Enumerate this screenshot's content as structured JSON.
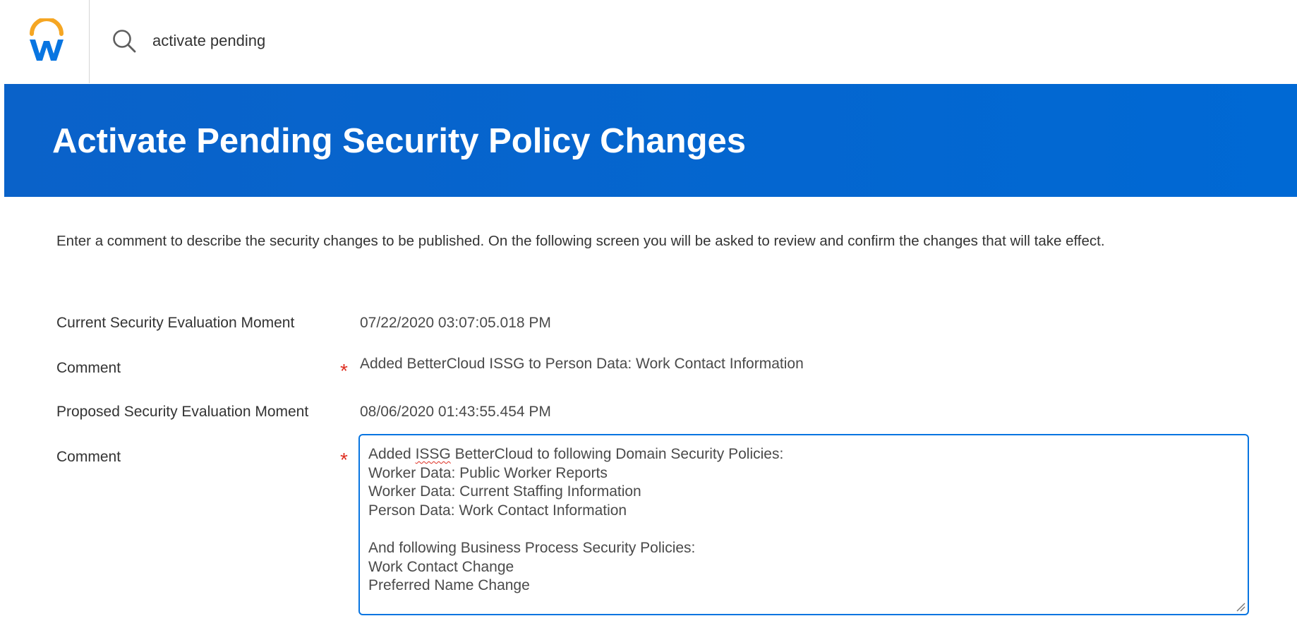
{
  "app": {
    "logo_icon": "workday-logo-icon",
    "brand_colors": {
      "arc": "#f5a623",
      "letter": "#0875e1",
      "header": "#0066cc"
    }
  },
  "search": {
    "icon": "search-icon",
    "value": "activate pending"
  },
  "page": {
    "title": "Activate Pending Security Policy Changes",
    "instructions": "Enter a comment to describe the security changes to be published. On the following screen you will be asked to review and confirm the changes that will take effect."
  },
  "fields": {
    "current_moment": {
      "label": "Current Security Evaluation Moment",
      "value": "07/22/2020 03:07:05.018 PM"
    },
    "current_comment": {
      "label": "Comment",
      "required_marker": "*",
      "value": "Added BetterCloud ISSG to Person Data: Work Contact Information"
    },
    "proposed_moment": {
      "label": "Proposed Security Evaluation Moment",
      "value": "08/06/2020 01:43:55.454 PM"
    },
    "proposed_comment": {
      "label": "Comment",
      "required_marker": "*",
      "lines": {
        "l0_a": "Added ",
        "l0_b": "ISSG",
        "l0_c": " BetterCloud to following Domain Security Policies:",
        "l1": "Worker Data: Public Worker Reports",
        "l2": "Worker Data: Current Staffing Information",
        "l3": "Person Data: Work Contact Information",
        "l4": "",
        "l5": "And following Business Process Security Policies:",
        "l6": "Work Contact Change",
        "l7": "Preferred Name Change"
      }
    }
  }
}
